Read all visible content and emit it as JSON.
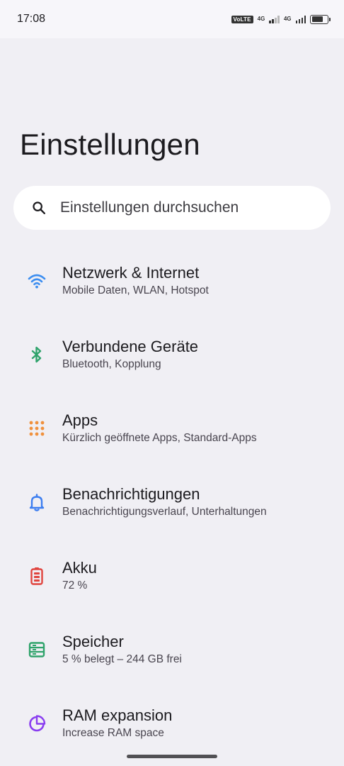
{
  "status_bar": {
    "time": "17:08",
    "volte_label": "VoLTE",
    "network_1": "4G",
    "network_2": "4G",
    "battery_level": 0.72
  },
  "page": {
    "title": "Einstellungen"
  },
  "search": {
    "placeholder": "Einstellungen durchsuchen",
    "icon": "search-icon"
  },
  "settings": [
    {
      "icon": "wifi-icon",
      "color": "#3d8ef0",
      "title": "Netzwerk & Internet",
      "subtitle": "Mobile Daten, WLAN, Hotspot"
    },
    {
      "icon": "bluetooth-icon",
      "color": "#2fa36b",
      "title": "Verbundene Geräte",
      "subtitle": "Bluetooth, Kopplung"
    },
    {
      "icon": "apps-grid-icon",
      "color": "#f0913d",
      "title": "Apps",
      "subtitle": "Kürzlich geöffnete Apps, Standard-Apps"
    },
    {
      "icon": "bell-icon",
      "color": "#3d7ef0",
      "title": "Benachrichtigungen",
      "subtitle": "Benachrichtigungsverlauf, Unterhaltungen"
    },
    {
      "icon": "battery-icon",
      "color": "#e0443e",
      "title": "Akku",
      "subtitle": "72 %"
    },
    {
      "icon": "storage-icon",
      "color": "#2fa36b",
      "title": "Speicher",
      "subtitle": "5 % belegt – 244 GB frei"
    },
    {
      "icon": "ram-expansion-icon",
      "color": "#8a3ef0",
      "title": "RAM expansion",
      "subtitle": "Increase RAM space"
    }
  ]
}
